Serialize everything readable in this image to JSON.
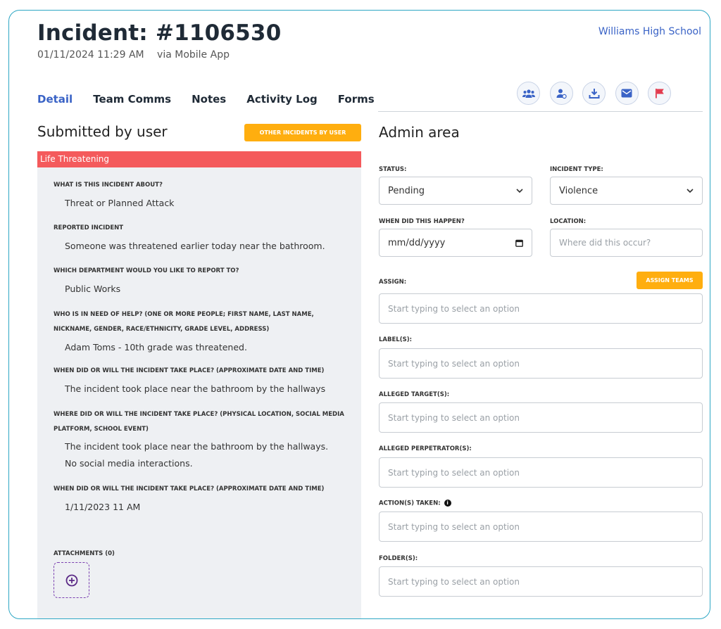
{
  "header": {
    "title": "Incident: #1106530",
    "datetime": "01/11/2024 11:29 AM",
    "source": "via Mobile App",
    "school": "Williams High School"
  },
  "tabs": [
    {
      "label": "Detail",
      "active": true
    },
    {
      "label": "Team Comms"
    },
    {
      "label": "Notes"
    },
    {
      "label": "Activity Log"
    },
    {
      "label": "Forms"
    }
  ],
  "action_icons": [
    "team-icon",
    "assign-user-icon",
    "download-icon",
    "mail-icon",
    "flag-icon"
  ],
  "left": {
    "heading": "Submitted by user",
    "other_button": "OTHER INCIDENTS BY USER",
    "severity": "Life Threatening",
    "qa": [
      {
        "q": "WHAT IS THIS INCIDENT ABOUT?",
        "a": "Threat or Planned Attack"
      },
      {
        "q": "REPORTED INCIDENT",
        "a": "Someone was threatened earlier today near the bathroom."
      },
      {
        "q": "WHICH DEPARTMENT WOULD YOU LIKE TO REPORT TO?",
        "a": "Public Works"
      },
      {
        "q": "WHO IS IN NEED OF HELP? (ONE OR MORE PEOPLE; FIRST NAME, LAST NAME, NICKNAME, GENDER, RACE/ETHNICITY, GRADE LEVEL, ADDRESS)",
        "a": "Adam Toms - 10th grade was threatened."
      },
      {
        "q": "WHEN DID OR WILL THE INCIDENT TAKE PLACE? (APPROXIMATE DATE AND TIME)",
        "a": "The incident took place near the bathroom by the hallways"
      },
      {
        "q": "WHERE DID OR WILL THE INCIDENT TAKE PLACE? (PHYSICAL LOCATION, SOCIAL MEDIA PLATFORM, SCHOOL EVENT)",
        "a": "The incident took place near the bathroom by the hallways. No social media interactions."
      },
      {
        "q": "WHEN DID OR WILL THE INCIDENT TAKE PLACE? (APPROXIMATE DATE AND TIME)",
        "a": "1/11/2023 11 AM"
      }
    ],
    "attachments_label": "ATTACHMENTS (0)"
  },
  "right": {
    "heading": "Admin area",
    "status": {
      "label": "STATUS:",
      "value": "Pending"
    },
    "incident_type": {
      "label": "INCIDENT TYPE:",
      "value": "Violence"
    },
    "when": {
      "label": "WHEN DID THIS HAPPEN?",
      "value": "mm/dd/yyyy"
    },
    "location": {
      "label": "LOCATION:",
      "placeholder": "Where did this occur?"
    },
    "assign": {
      "label": "ASSIGN:",
      "placeholder": "Start typing to select an option",
      "button": "ASSIGN TEAMS"
    },
    "labels": {
      "label": "LABEL(S):",
      "placeholder": "Start typing to select an option"
    },
    "targets": {
      "label": "ALLEGED TARGET(S):",
      "placeholder": "Start typing to select an option"
    },
    "perpetrators": {
      "label": "ALLEGED PERPETRATOR(S):",
      "placeholder": "Start typing to select an option"
    },
    "actions": {
      "label": "ACTION(S) TAKEN:",
      "placeholder": "Start typing to select an option"
    },
    "folders": {
      "label": "FOLDER(S):",
      "placeholder": "Start typing to select an option"
    }
  },
  "colors": {
    "accent": "#3a63c6",
    "orange": "#ffae0f",
    "danger": "#f45a5c",
    "border": "#2ea7c4",
    "panel": "#eef0f3"
  }
}
